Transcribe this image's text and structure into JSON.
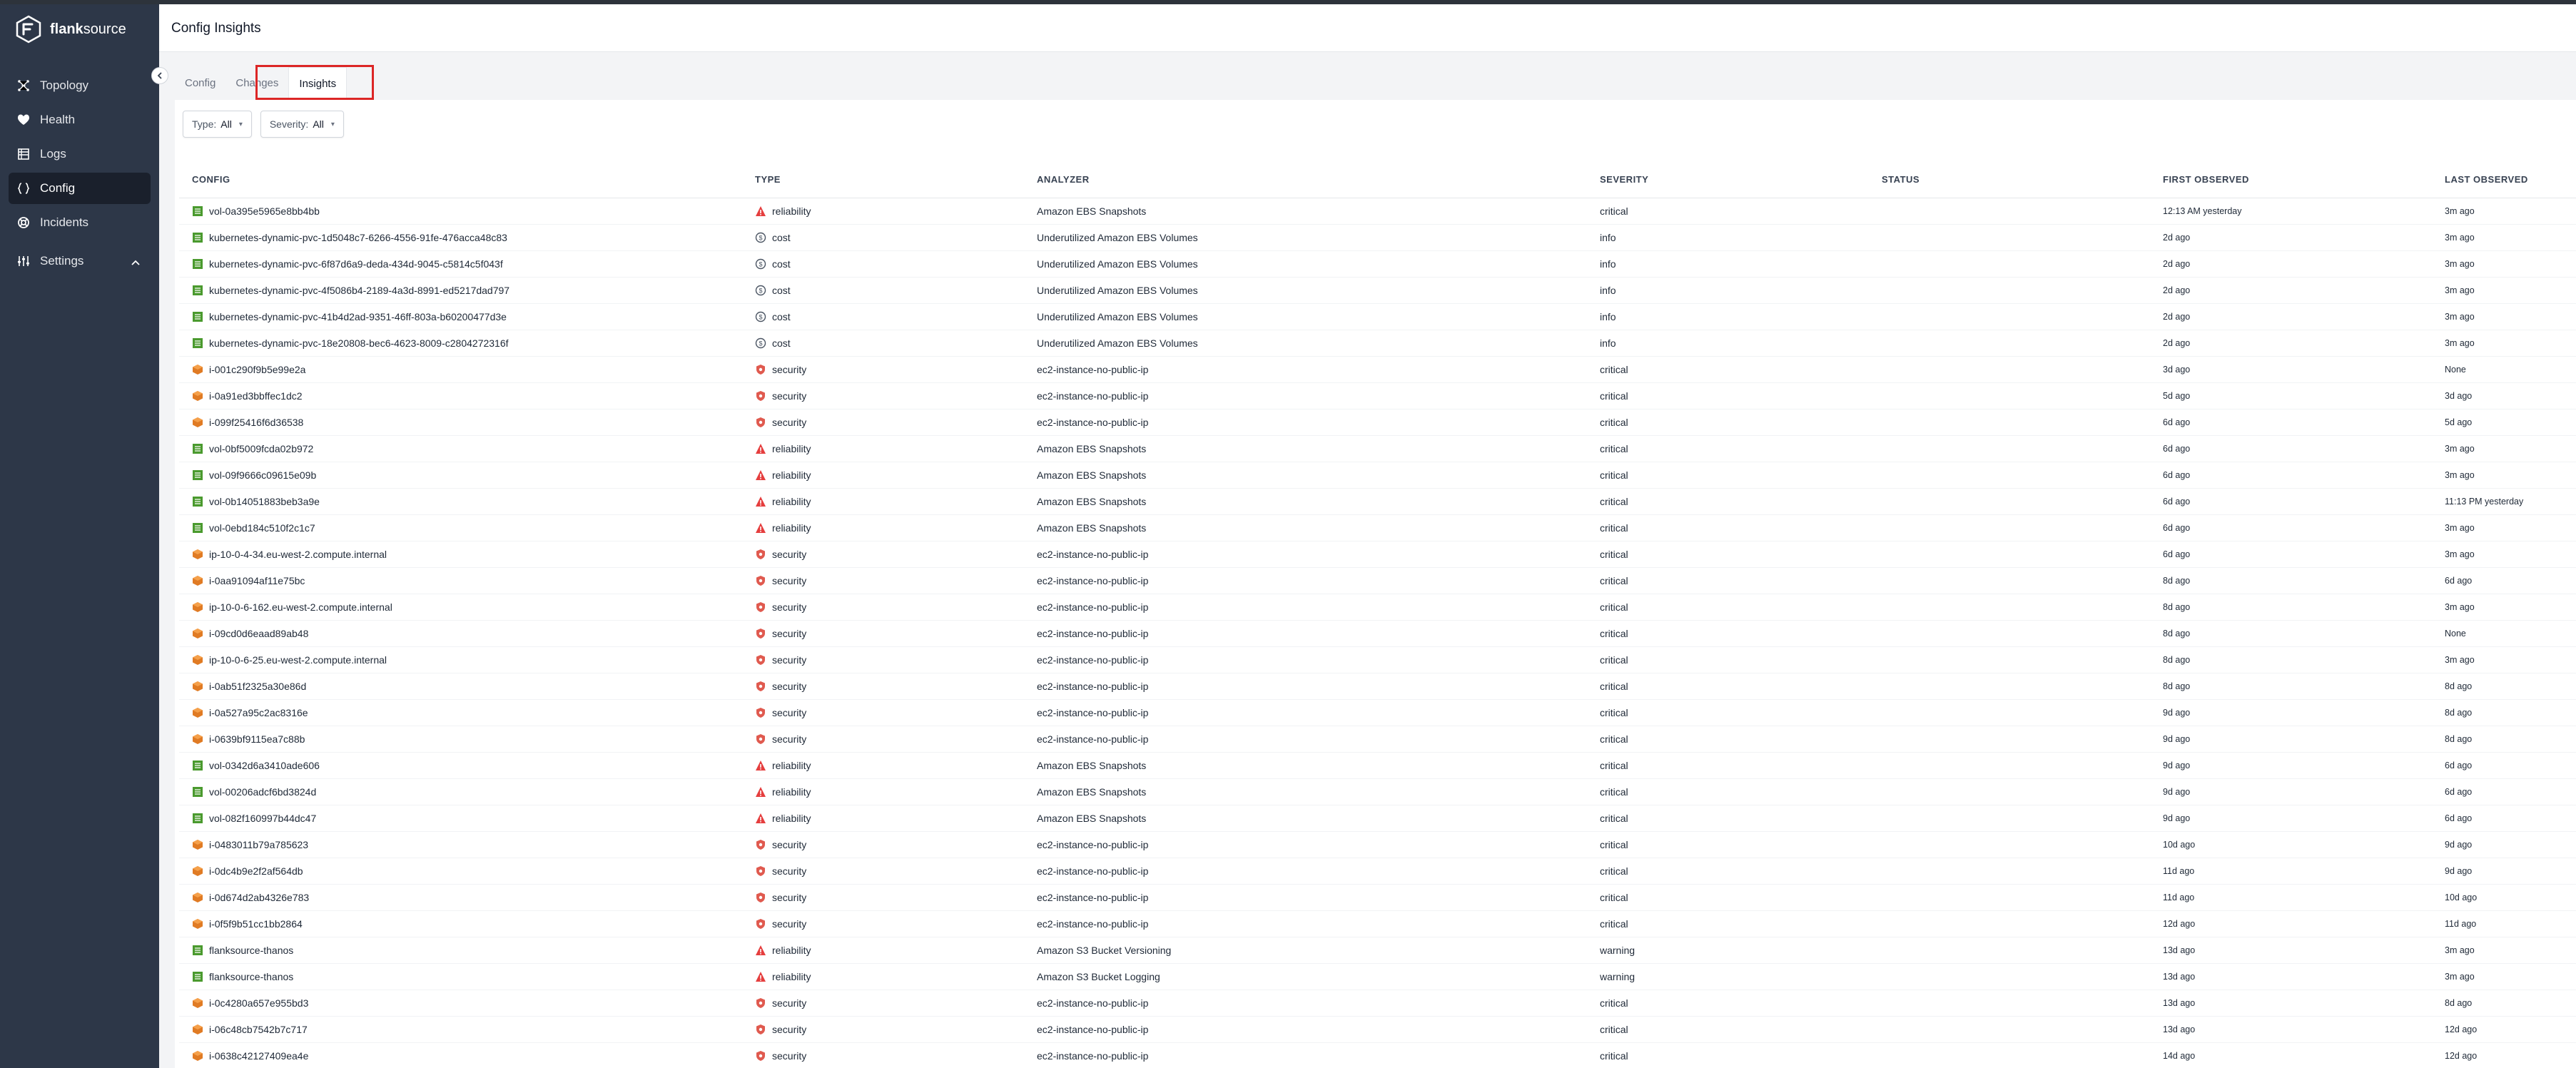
{
  "app": {
    "brand_bold": "flank",
    "brand_light": "source",
    "page_title": "Config Insights"
  },
  "sidebar": {
    "items": [
      {
        "key": "topology",
        "label": "Topology",
        "icon": "topology-icon"
      },
      {
        "key": "health",
        "label": "Health",
        "icon": "heart-icon"
      },
      {
        "key": "logs",
        "label": "Logs",
        "icon": "logs-icon"
      },
      {
        "key": "config",
        "label": "Config",
        "icon": "braces-icon",
        "active": true
      },
      {
        "key": "incidents",
        "label": "Incidents",
        "icon": "lifebuoy-icon"
      },
      {
        "key": "settings",
        "label": "Settings",
        "icon": "sliders-icon"
      }
    ]
  },
  "tabs": [
    {
      "label": "Config"
    },
    {
      "label": "Changes"
    },
    {
      "label": "Insights",
      "active": true
    }
  ],
  "filters": {
    "type": {
      "label": "Type:",
      "value": "All"
    },
    "severity": {
      "label": "Severity:",
      "value": "All"
    }
  },
  "table": {
    "columns": [
      "CONFIG",
      "TYPE",
      "ANALYZER",
      "SEVERITY",
      "STATUS",
      "FIRST OBSERVED",
      "LAST OBSERVED"
    ],
    "rows": [
      {
        "config": "vol-0a395e5965e8bb4bb",
        "kind": "volume",
        "type": "reliability",
        "analyzer": "Amazon EBS Snapshots",
        "severity": "critical",
        "status": "",
        "first": "12:13 AM yesterday",
        "last": "3m ago"
      },
      {
        "config": "kubernetes-dynamic-pvc-1d5048c7-6266-4556-91fe-476acca48c83",
        "kind": "volume",
        "type": "cost",
        "analyzer": "Underutilized Amazon EBS Volumes",
        "severity": "info",
        "status": "",
        "first": "2d ago",
        "last": "3m ago"
      },
      {
        "config": "kubernetes-dynamic-pvc-6f87d6a9-deda-434d-9045-c5814c5f043f",
        "kind": "volume",
        "type": "cost",
        "analyzer": "Underutilized Amazon EBS Volumes",
        "severity": "info",
        "status": "",
        "first": "2d ago",
        "last": "3m ago"
      },
      {
        "config": "kubernetes-dynamic-pvc-4f5086b4-2189-4a3d-8991-ed5217dad797",
        "kind": "volume",
        "type": "cost",
        "analyzer": "Underutilized Amazon EBS Volumes",
        "severity": "info",
        "status": "",
        "first": "2d ago",
        "last": "3m ago"
      },
      {
        "config": "kubernetes-dynamic-pvc-41b4d2ad-9351-46ff-803a-b60200477d3e",
        "kind": "volume",
        "type": "cost",
        "analyzer": "Underutilized Amazon EBS Volumes",
        "severity": "info",
        "status": "",
        "first": "2d ago",
        "last": "3m ago"
      },
      {
        "config": "kubernetes-dynamic-pvc-18e20808-bec6-4623-8009-c2804272316f",
        "kind": "volume",
        "type": "cost",
        "analyzer": "Underutilized Amazon EBS Volumes",
        "severity": "info",
        "status": "",
        "first": "2d ago",
        "last": "3m ago"
      },
      {
        "config": "i-001c290f9b5e99e2a",
        "kind": "instance",
        "type": "security",
        "analyzer": "ec2-instance-no-public-ip",
        "severity": "critical",
        "status": "",
        "first": "3d ago",
        "last": "None"
      },
      {
        "config": "i-0a91ed3bbffec1dc2",
        "kind": "instance",
        "type": "security",
        "analyzer": "ec2-instance-no-public-ip",
        "severity": "critical",
        "status": "",
        "first": "5d ago",
        "last": "3d ago"
      },
      {
        "config": "i-099f25416f6d36538",
        "kind": "instance",
        "type": "security",
        "analyzer": "ec2-instance-no-public-ip",
        "severity": "critical",
        "status": "",
        "first": "6d ago",
        "last": "5d ago"
      },
      {
        "config": "vol-0bf5009fcda02b972",
        "kind": "volume",
        "type": "reliability",
        "analyzer": "Amazon EBS Snapshots",
        "severity": "critical",
        "status": "",
        "first": "6d ago",
        "last": "3m ago"
      },
      {
        "config": "vol-09f9666c09615e09b",
        "kind": "volume",
        "type": "reliability",
        "analyzer": "Amazon EBS Snapshots",
        "severity": "critical",
        "status": "",
        "first": "6d ago",
        "last": "3m ago"
      },
      {
        "config": "vol-0b14051883beb3a9e",
        "kind": "volume",
        "type": "reliability",
        "analyzer": "Amazon EBS Snapshots",
        "severity": "critical",
        "status": "",
        "first": "6d ago",
        "last": "11:13 PM yesterday"
      },
      {
        "config": "vol-0ebd184c510f2c1c7",
        "kind": "volume",
        "type": "reliability",
        "analyzer": "Amazon EBS Snapshots",
        "severity": "critical",
        "status": "",
        "first": "6d ago",
        "last": "3m ago"
      },
      {
        "config": "ip-10-0-4-34.eu-west-2.compute.internal",
        "kind": "instance",
        "type": "security",
        "analyzer": "ec2-instance-no-public-ip",
        "severity": "critical",
        "status": "",
        "first": "6d ago",
        "last": "3m ago"
      },
      {
        "config": "i-0aa91094af11e75bc",
        "kind": "instance",
        "type": "security",
        "analyzer": "ec2-instance-no-public-ip",
        "severity": "critical",
        "status": "",
        "first": "8d ago",
        "last": "6d ago"
      },
      {
        "config": "ip-10-0-6-162.eu-west-2.compute.internal",
        "kind": "instance",
        "type": "security",
        "analyzer": "ec2-instance-no-public-ip",
        "severity": "critical",
        "status": "",
        "first": "8d ago",
        "last": "3m ago"
      },
      {
        "config": "i-09cd0d6eaad89ab48",
        "kind": "instance",
        "type": "security",
        "analyzer": "ec2-instance-no-public-ip",
        "severity": "critical",
        "status": "",
        "first": "8d ago",
        "last": "None"
      },
      {
        "config": "ip-10-0-6-25.eu-west-2.compute.internal",
        "kind": "instance",
        "type": "security",
        "analyzer": "ec2-instance-no-public-ip",
        "severity": "critical",
        "status": "",
        "first": "8d ago",
        "last": "3m ago"
      },
      {
        "config": "i-0ab51f2325a30e86d",
        "kind": "instance",
        "type": "security",
        "analyzer": "ec2-instance-no-public-ip",
        "severity": "critical",
        "status": "",
        "first": "8d ago",
        "last": "8d ago"
      },
      {
        "config": "i-0a527a95c2ac8316e",
        "kind": "instance",
        "type": "security",
        "analyzer": "ec2-instance-no-public-ip",
        "severity": "critical",
        "status": "",
        "first": "9d ago",
        "last": "8d ago"
      },
      {
        "config": "i-0639bf9115ea7c88b",
        "kind": "instance",
        "type": "security",
        "analyzer": "ec2-instance-no-public-ip",
        "severity": "critical",
        "status": "",
        "first": "9d ago",
        "last": "8d ago"
      },
      {
        "config": "vol-0342d6a3410ade606",
        "kind": "volume",
        "type": "reliability",
        "analyzer": "Amazon EBS Snapshots",
        "severity": "critical",
        "status": "",
        "first": "9d ago",
        "last": "6d ago"
      },
      {
        "config": "vol-00206adcf6bd3824d",
        "kind": "volume",
        "type": "reliability",
        "analyzer": "Amazon EBS Snapshots",
        "severity": "critical",
        "status": "",
        "first": "9d ago",
        "last": "6d ago"
      },
      {
        "config": "vol-082f160997b44dc47",
        "kind": "volume",
        "type": "reliability",
        "analyzer": "Amazon EBS Snapshots",
        "severity": "critical",
        "status": "",
        "first": "9d ago",
        "last": "6d ago"
      },
      {
        "config": "i-0483011b79a785623",
        "kind": "instance",
        "type": "security",
        "analyzer": "ec2-instance-no-public-ip",
        "severity": "critical",
        "status": "",
        "first": "10d ago",
        "last": "9d ago"
      },
      {
        "config": "i-0dc4b9e2f2af564db",
        "kind": "instance",
        "type": "security",
        "analyzer": "ec2-instance-no-public-ip",
        "severity": "critical",
        "status": "",
        "first": "11d ago",
        "last": "9d ago"
      },
      {
        "config": "i-0d674d2ab4326e783",
        "kind": "instance",
        "type": "security",
        "analyzer": "ec2-instance-no-public-ip",
        "severity": "critical",
        "status": "",
        "first": "11d ago",
        "last": "10d ago"
      },
      {
        "config": "i-0f5f9b51cc1bb2864",
        "kind": "instance",
        "type": "security",
        "analyzer": "ec2-instance-no-public-ip",
        "severity": "critical",
        "status": "",
        "first": "12d ago",
        "last": "11d ago"
      },
      {
        "config": "flanksource-thanos",
        "kind": "volume",
        "type": "reliability",
        "analyzer": "Amazon S3 Bucket Versioning",
        "severity": "warning",
        "status": "",
        "first": "13d ago",
        "last": "3m ago"
      },
      {
        "config": "flanksource-thanos",
        "kind": "volume",
        "type": "reliability",
        "analyzer": "Amazon S3 Bucket Logging",
        "severity": "warning",
        "status": "",
        "first": "13d ago",
        "last": "3m ago"
      },
      {
        "config": "i-0c4280a657e955bd3",
        "kind": "instance",
        "type": "security",
        "analyzer": "ec2-instance-no-public-ip",
        "severity": "critical",
        "status": "",
        "first": "13d ago",
        "last": "8d ago"
      },
      {
        "config": "i-06c48cb7542b7c717",
        "kind": "instance",
        "type": "security",
        "analyzer": "ec2-instance-no-public-ip",
        "severity": "critical",
        "status": "",
        "first": "13d ago",
        "last": "12d ago"
      },
      {
        "config": "i-0638c42127409ea4e",
        "kind": "instance",
        "type": "security",
        "analyzer": "ec2-instance-no-public-ip",
        "severity": "critical",
        "status": "",
        "first": "14d ago",
        "last": "12d ago"
      }
    ]
  },
  "colors": {
    "sidebar_bg": "#2d3748",
    "sidebar_active": "#1a202c",
    "volume_icon": "#4a9a2e",
    "instance_icon": "#e07b24",
    "reliability_icon": "#e53e3e",
    "cost_icon": "#4b5563",
    "security_icon": "#e05a4f",
    "highlight": "#dc2626"
  }
}
